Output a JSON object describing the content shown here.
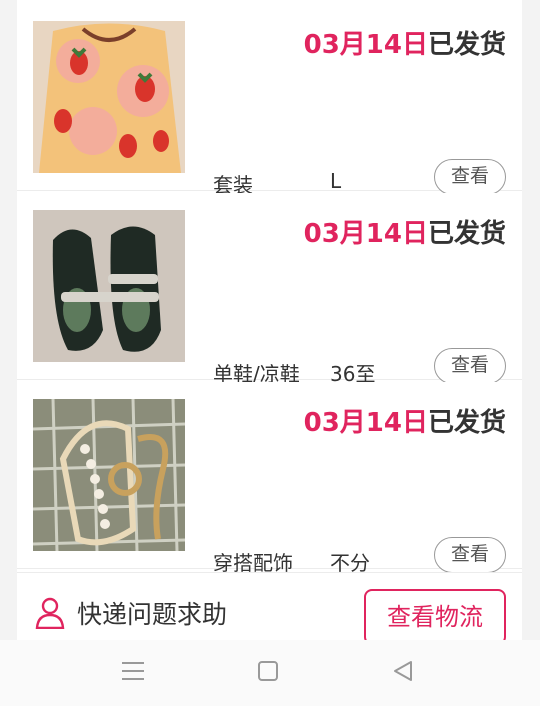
{
  "orders": [
    {
      "date": "03月14日",
      "status": "已发货",
      "category": "套装",
      "spec": "L",
      "view_label": "查看"
    },
    {
      "date": "03月14日",
      "status": "已发货",
      "category": "单鞋/凉鞋",
      "spec": "36至",
      "view_label": "查看"
    },
    {
      "date": "03月14日",
      "status": "已发货",
      "category": "穿搭配饰",
      "spec": "不分",
      "view_label": "查看"
    }
  ],
  "footer": {
    "help_label": "快递问题求助",
    "logistics_label": "查看物流"
  },
  "icons": {
    "help": "person-icon",
    "menu": "menu-icon",
    "home": "square-icon",
    "back": "back-triangle-icon"
  },
  "colors": {
    "accent": "#e0245e"
  }
}
